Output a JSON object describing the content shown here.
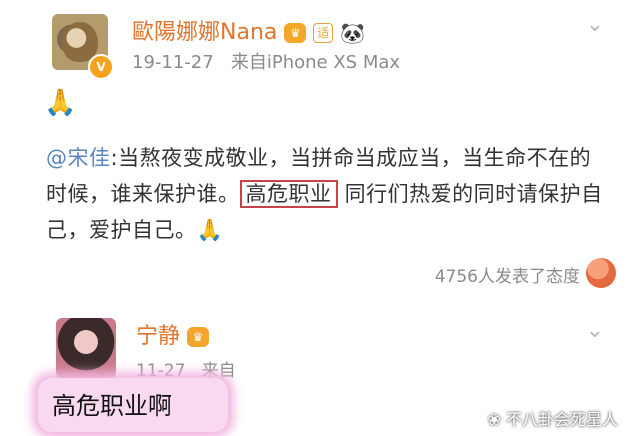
{
  "post": {
    "author": "歐陽娜娜Nana",
    "timestamp": "19-11-27",
    "source": "来自iPhone XS Max",
    "emoji_line": "🙏",
    "mention": "@宋佳",
    "text_1": ":当熬夜变成敬业，当拼命当成应当，当生命不在的时候，谁来保护谁。",
    "text_highlight": "高危职业",
    "text_2": " 同行们热爱的同时请保护自己，爱护自己。",
    "trailing_emoji": "🙏",
    "reactions": "4756人发表了态度"
  },
  "comment": {
    "author": "宁静",
    "timestamp": "11-27",
    "source": "来自",
    "text": "高危职业啊"
  },
  "watermark": "不八卦会死星人",
  "icons": {
    "verified": "v-badge-icon",
    "crown": "crown-icon",
    "tie": "tie-icon",
    "panda": "panda-icon",
    "chevron": "chevron-down-icon",
    "reaction": "reaction-face-icon"
  },
  "colors": {
    "username": "#e0752b",
    "mention": "#5b86c2",
    "box": "#c8424a",
    "highlight": "#f8d9ef"
  }
}
